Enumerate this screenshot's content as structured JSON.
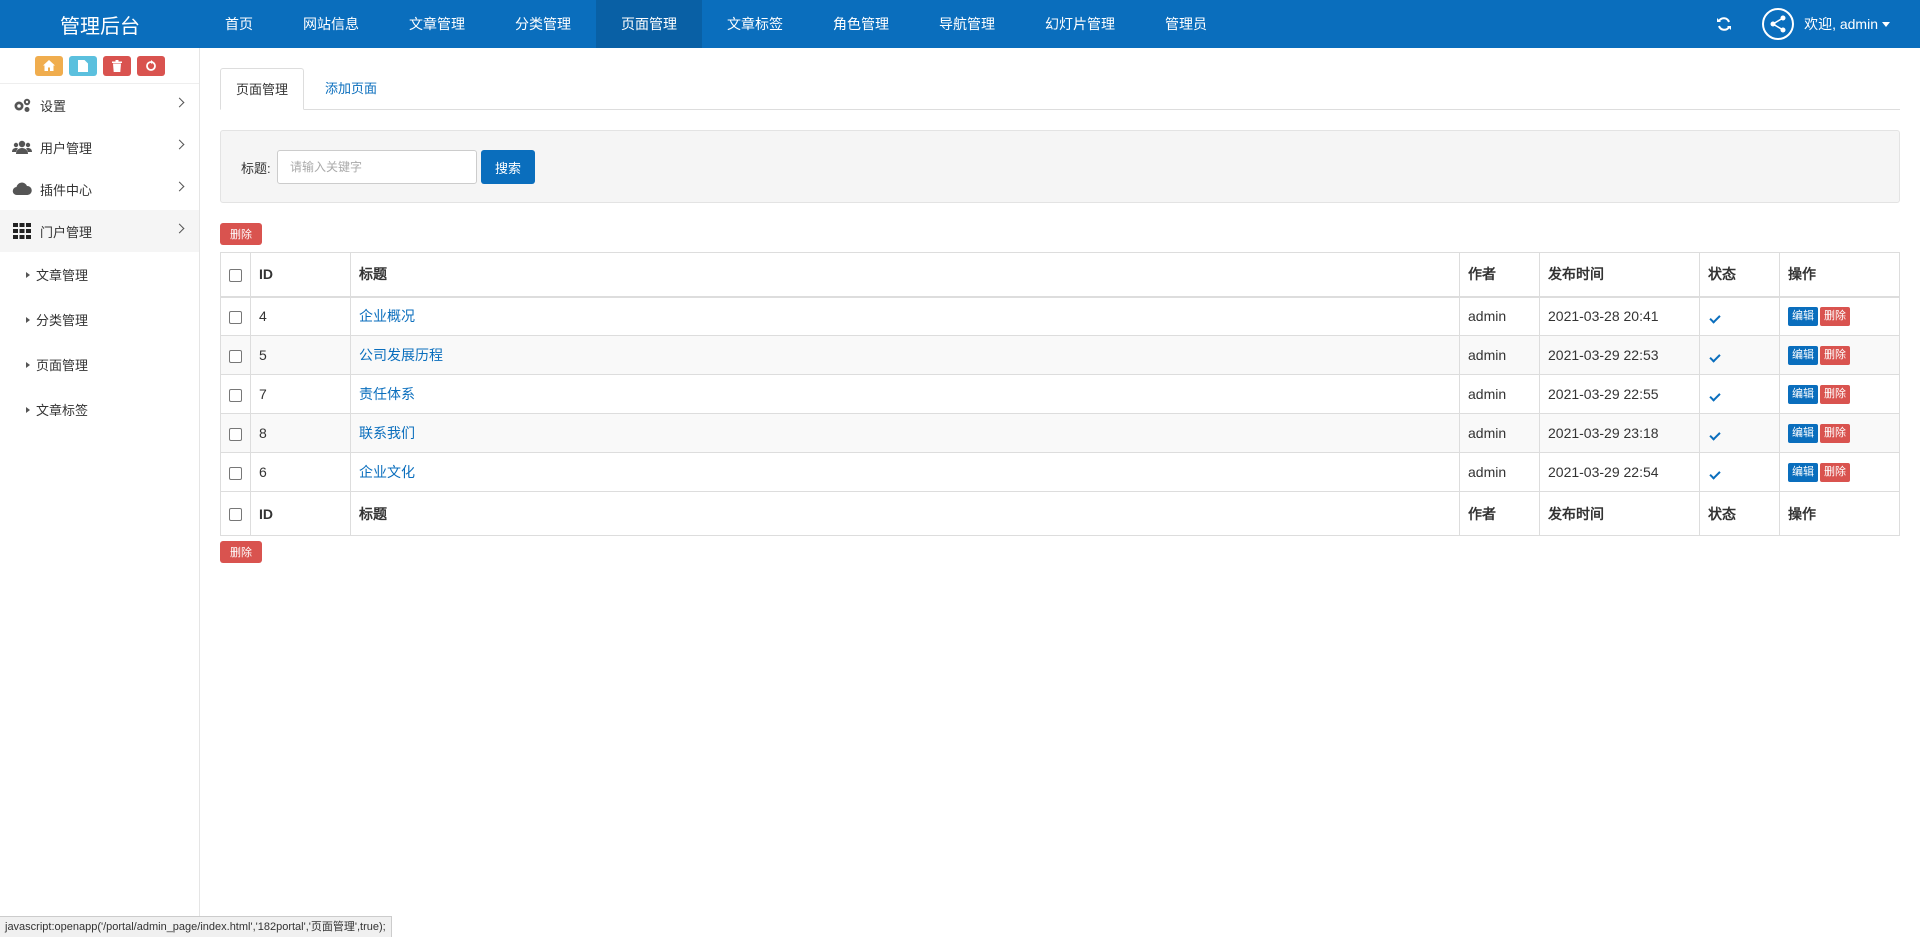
{
  "header": {
    "brand": "管理后台",
    "nav": [
      {
        "label": "首页"
      },
      {
        "label": "网站信息"
      },
      {
        "label": "文章管理"
      },
      {
        "label": "分类管理"
      },
      {
        "label": "页面管理"
      },
      {
        "label": "文章标签"
      },
      {
        "label": "角色管理"
      },
      {
        "label": "导航管理"
      },
      {
        "label": "幻灯片管理"
      },
      {
        "label": "管理员"
      }
    ],
    "active_nav": "页面管理",
    "welcome": "欢迎, admin"
  },
  "sidebar": {
    "items": [
      {
        "label": "设置",
        "icon": "gears-icon"
      },
      {
        "label": "用户管理",
        "icon": "users-icon"
      },
      {
        "label": "插件中心",
        "icon": "cloud-icon"
      },
      {
        "label": "门户管理",
        "icon": "grid-icon"
      }
    ],
    "sub_items": [
      {
        "label": "文章管理"
      },
      {
        "label": "分类管理"
      },
      {
        "label": "页面管理"
      },
      {
        "label": "文章标签"
      }
    ]
  },
  "tabs": {
    "active": "页面管理",
    "add": "添加页面"
  },
  "search": {
    "label": "标题:",
    "placeholder": "请输入关键字",
    "button": "搜索"
  },
  "bulk_delete": "删除",
  "table": {
    "headers": {
      "id": "ID",
      "title": "标题",
      "author": "作者",
      "time": "发布时间",
      "status": "状态",
      "ops": "操作"
    },
    "rows": [
      {
        "id": "4",
        "title": "企业概况",
        "author": "admin",
        "time": "2021-03-28 20:41"
      },
      {
        "id": "5",
        "title": "公司发展历程",
        "author": "admin",
        "time": "2021-03-29 22:53"
      },
      {
        "id": "7",
        "title": "责任体系",
        "author": "admin",
        "time": "2021-03-29 22:55"
      },
      {
        "id": "8",
        "title": "联系我们",
        "author": "admin",
        "time": "2021-03-29 23:18"
      },
      {
        "id": "6",
        "title": "企业文化",
        "author": "admin",
        "time": "2021-03-29 22:54"
      }
    ],
    "edit_label": "编辑",
    "delete_label": "删除"
  },
  "statusbar": "javascript:openapp('/portal/admin_page/index.html','182portal','页面管理',true);",
  "colors": {
    "primary": "#0a6ebd",
    "danger": "#d9534f",
    "warning": "#f0ad4e",
    "info": "#5bc0de"
  }
}
